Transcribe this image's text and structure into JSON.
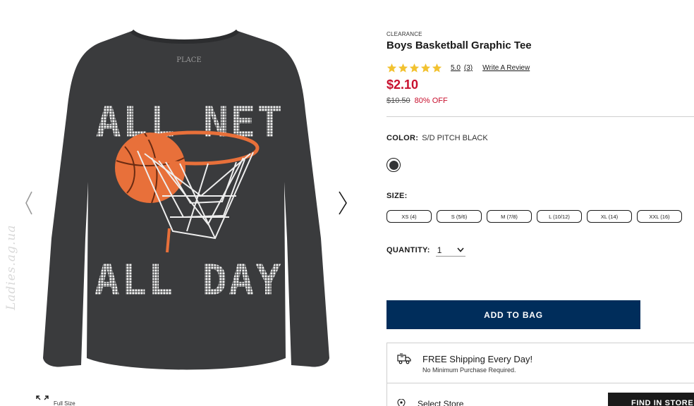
{
  "product": {
    "eyebrow": "CLEARANCE",
    "title": "Boys Basketball Graphic Tee",
    "rating": {
      "stars": 5,
      "score": "5.0",
      "count": "(3)",
      "write_review": "Write A Review",
      "star_color": "#f2c230"
    },
    "price": "$2.10",
    "original_price": "$10.50",
    "discount": "80% OFF",
    "price_color": "#c8102e"
  },
  "color": {
    "label": "COLOR:",
    "value": "S/D PITCH BLACK",
    "swatch_color": "#333436"
  },
  "size": {
    "label": "SIZE:",
    "options": [
      "XS (4)",
      "S (5/6)",
      "M (7/8)",
      "L (10/12)",
      "XL (14)",
      "XXL (16)"
    ]
  },
  "quantity": {
    "label": "QUANTITY:",
    "value": "1"
  },
  "add_to_bag": {
    "label": "ADD TO BAG",
    "color": "#002d5b"
  },
  "shipping": {
    "title": "FREE Shipping Every Day!",
    "subtitle": "No Minimum Purchase Required."
  },
  "store": {
    "label": "Select Store",
    "find_button": "FIND IN STORE"
  },
  "gallery": {
    "full_size_label": "Full Size",
    "watermark": "Ladies.ag.ua",
    "shirt": {
      "brand_tag": "PLACE",
      "line1": "ALL NET",
      "line2": "ALL DAY",
      "shirt_color": "#3a3b3d",
      "ball_color": "#e8703a"
    }
  }
}
